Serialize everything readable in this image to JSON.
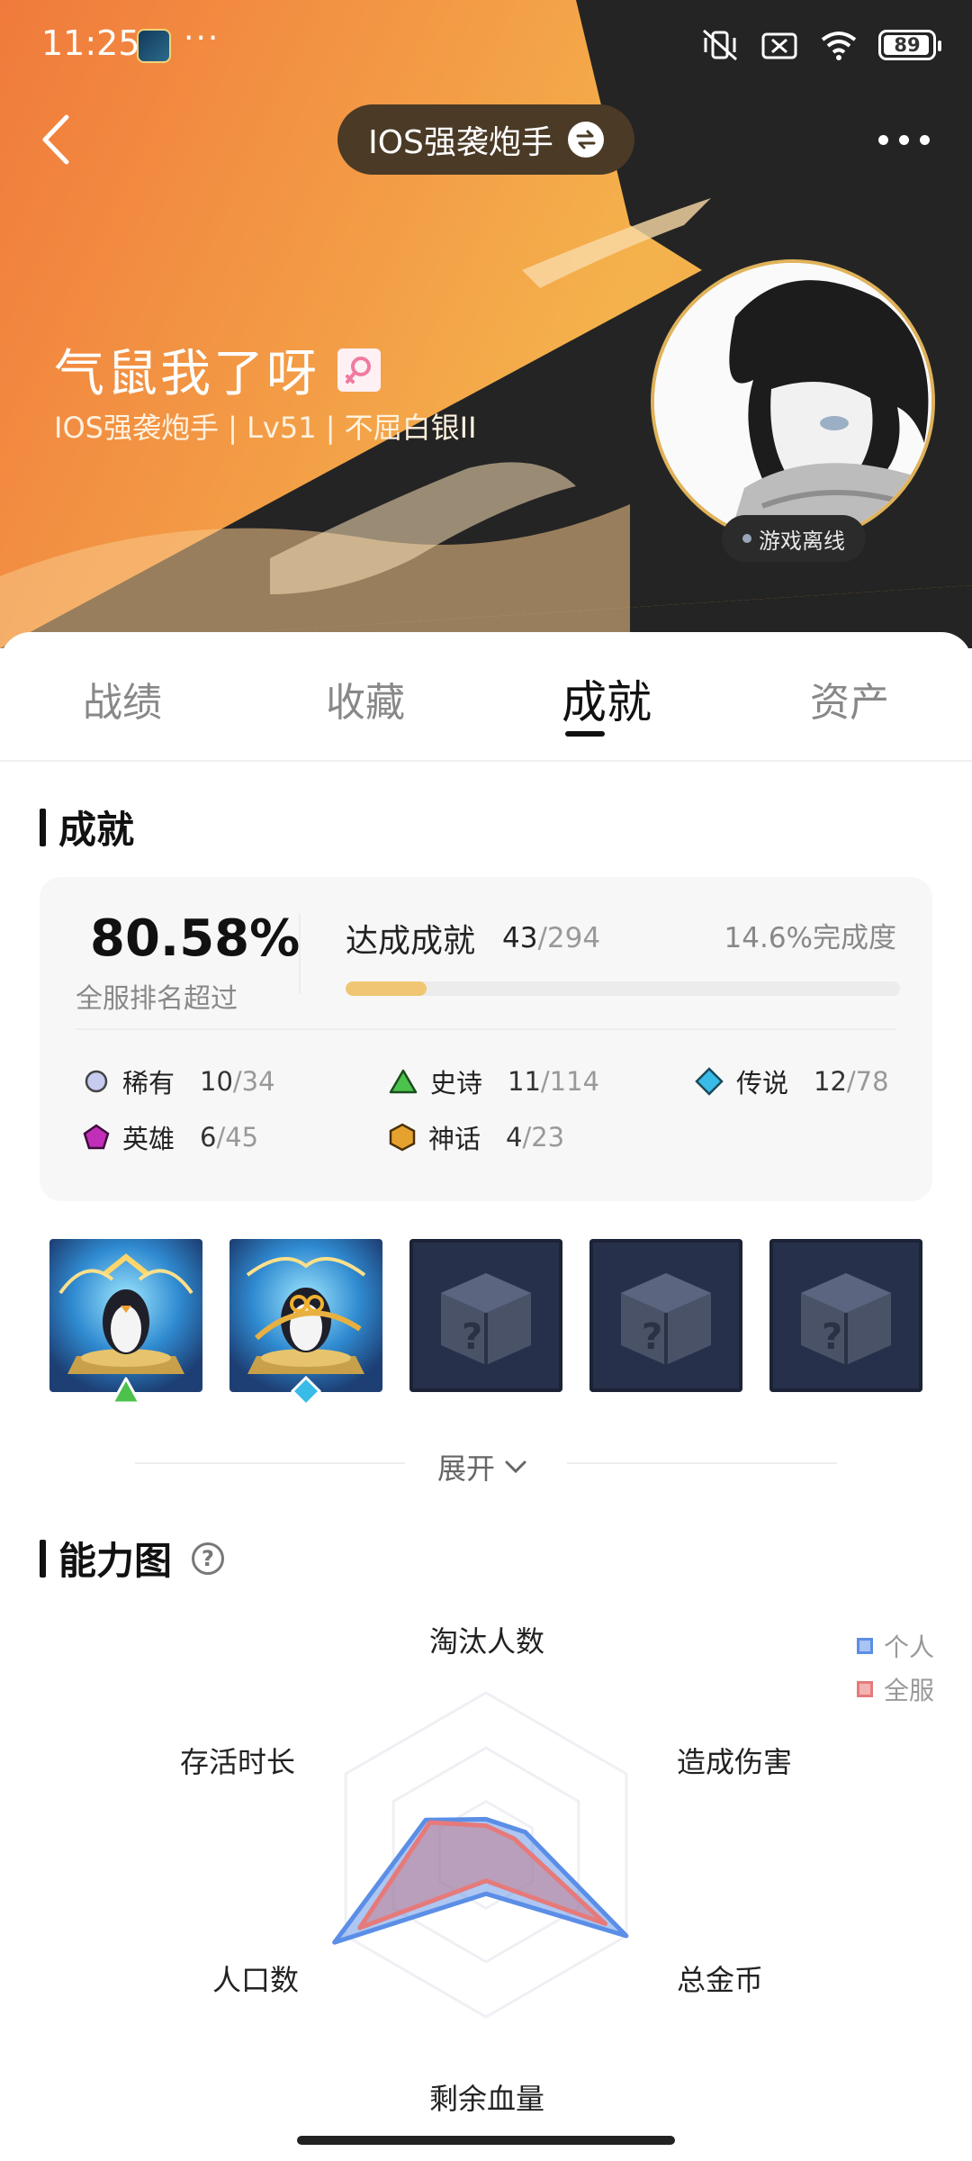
{
  "status_bar": {
    "time": "11:25",
    "battery": "89"
  },
  "header": {
    "server_title": "IOS强袭炮手",
    "nickname": "气鼠我了呀",
    "sub_info": "IOS强袭炮手 | Lv51 | 不屈白银II",
    "online_status": "游戏离线"
  },
  "tabs": [
    {
      "label": "战绩",
      "active": false
    },
    {
      "label": "收藏",
      "active": false
    },
    {
      "label": "成就",
      "active": true
    },
    {
      "label": "资产",
      "active": false
    }
  ],
  "achievements": {
    "section_title": "成就",
    "rank_percent": "80.58%",
    "rank_label": "全服排名超过",
    "achieved_label": "达成成就",
    "achieved": "43",
    "total": "/294",
    "completion_rate": "14.6%完成度",
    "progress_fraction": 0.146,
    "rarities": [
      {
        "name": "稀有",
        "got": "10",
        "total": "/34",
        "icon": "rare-circle-icon",
        "color": "#b8bde6"
      },
      {
        "name": "史诗",
        "got": "11",
        "total": "/114",
        "icon": "epic-triangle-icon",
        "color": "#4cc24c"
      },
      {
        "name": "传说",
        "got": "12",
        "total": "/78",
        "icon": "legend-diamond-icon",
        "color": "#34b7e4"
      },
      {
        "name": "英雄",
        "got": "6",
        "total": "/45",
        "icon": "hero-pentagon-icon",
        "color": "#c12fb8"
      },
      {
        "name": "神话",
        "got": "4",
        "total": "/23",
        "icon": "myth-hexagon-icon",
        "color": "#e6a22e"
      }
    ],
    "tiles": [
      {
        "state": "earned",
        "badge": "epic-triangle-icon"
      },
      {
        "state": "earned",
        "badge": "legend-diamond-icon"
      },
      {
        "state": "locked"
      },
      {
        "state": "locked"
      },
      {
        "state": "locked"
      }
    ],
    "expand_label": "展开"
  },
  "ability": {
    "section_title": "能力图",
    "legend": [
      {
        "name": "个人",
        "color": "#5b8ee6"
      },
      {
        "name": "全服",
        "color": "#e67a7a"
      }
    ],
    "axes": [
      "淘汰人数",
      "造成伤害",
      "总金币",
      "剩余血量",
      "人口数",
      "存活时长"
    ],
    "personal": [
      0.22,
      0.28,
      1.0,
      0.24,
      1.08,
      0.43
    ],
    "server": [
      0.18,
      0.2,
      0.85,
      0.16,
      0.9,
      0.4
    ]
  }
}
